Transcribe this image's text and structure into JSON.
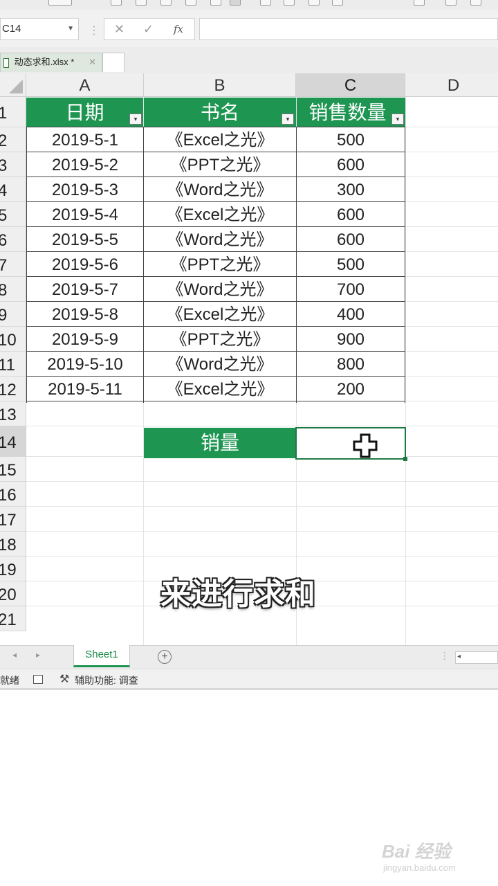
{
  "formula_bar": {
    "name_box": "C14",
    "cancel_symbol": "✕",
    "enter_symbol": "✓",
    "fx_symbol": "fx",
    "formula": ""
  },
  "file_tab": {
    "name": "动态求和.xlsx *",
    "close_symbol": "✕"
  },
  "columns": [
    "A",
    "B",
    "C",
    "D"
  ],
  "rows": [
    "1",
    "2",
    "3",
    "4",
    "5",
    "6",
    "7",
    "8",
    "9",
    "10",
    "11",
    "12",
    "13",
    "14",
    "15",
    "16",
    "17",
    "18",
    "19",
    "20",
    "21"
  ],
  "table": {
    "headers": [
      "日期",
      "书名",
      "销售数量"
    ],
    "data": [
      [
        "2019-5-1",
        "《Excel之光》",
        "500"
      ],
      [
        "2019-5-2",
        "《PPT之光》",
        "600"
      ],
      [
        "2019-5-3",
        "《Word之光》",
        "300"
      ],
      [
        "2019-5-4",
        "《Excel之光》",
        "600"
      ],
      [
        "2019-5-5",
        "《Word之光》",
        "600"
      ],
      [
        "2019-5-6",
        "《PPT之光》",
        "500"
      ],
      [
        "2019-5-7",
        "《Word之光》",
        "700"
      ],
      [
        "2019-5-8",
        "《Excel之光》",
        "400"
      ],
      [
        "2019-5-9",
        "《PPT之光》",
        "900"
      ],
      [
        "2019-5-10",
        "《Word之光》",
        "800"
      ],
      [
        "2019-5-11",
        "《Excel之光》",
        "200"
      ]
    ],
    "filter_symbol": "▾"
  },
  "summary": {
    "label": "销量",
    "value": ""
  },
  "subtitle": "来进行求和",
  "sheet_tabs": {
    "active": "Sheet1",
    "add_symbol": "+",
    "nav_prev": "◂",
    "nav_next": "▸"
  },
  "status": {
    "ready": "就绪",
    "accessibility": "辅助功能: 调查"
  },
  "watermark": {
    "main": "Bai 经验",
    "sub": "jingyan.baidu.com"
  },
  "colors": {
    "header_green": "#1e9652",
    "selection_green": "#1e7a43"
  }
}
